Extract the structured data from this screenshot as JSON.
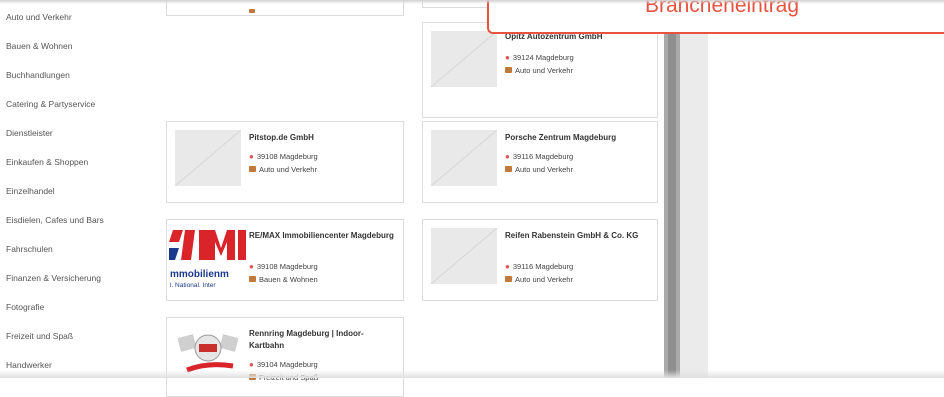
{
  "sidebar": {
    "categories": [
      "Auto und Verkehr",
      "Bauen & Wohnen",
      "Buchhandlungen",
      "Catering & Partyservice",
      "Dienstleister",
      "Einkaufen & Shoppen",
      "Einzelhandel",
      "Eisdielen, Cafes und Bars",
      "Fahrschulen",
      "Finanzen & Versicherung",
      "Fotografie",
      "Freizeit und Spaß",
      "Handwerker"
    ]
  },
  "banner": {
    "label": "Brancheneintrag"
  },
  "listings": [
    {
      "name": "Opitz Autozentrum GmbH",
      "location": "39124 Magdeburg",
      "category": "Auto und Verkehr"
    },
    {
      "name": "Pitstop.de GmbH",
      "location": "39108 Magdeburg",
      "category": "Auto und Verkehr"
    },
    {
      "name": "Porsche Zentrum Magdeburg",
      "location": "39116 Magdeburg",
      "category": "Auto und Verkehr"
    },
    {
      "name": "RE/MAX Immobiliencenter Magdeburg",
      "location": "39108 Magdeburg",
      "category": "Bauen & Wohnen",
      "logo_text_1": "mmobilienm",
      "logo_text_2": "l. National. Inter"
    },
    {
      "name": "Reifen Rabenstein GmbH & Co. KG",
      "location": "39116 Magdeburg",
      "category": "Auto und Verkehr"
    },
    {
      "name": "Rennring Magdeburg | Indoor-Kartbahn",
      "location": "39104 Magdeburg",
      "category": "Freizeit und Spaß"
    }
  ],
  "colors": {
    "accent": "#e8533f",
    "pin": "#d9534f",
    "bag": "#c1793b"
  },
  "icons": {
    "location": "map-pin-icon",
    "category": "briefcase-icon"
  }
}
